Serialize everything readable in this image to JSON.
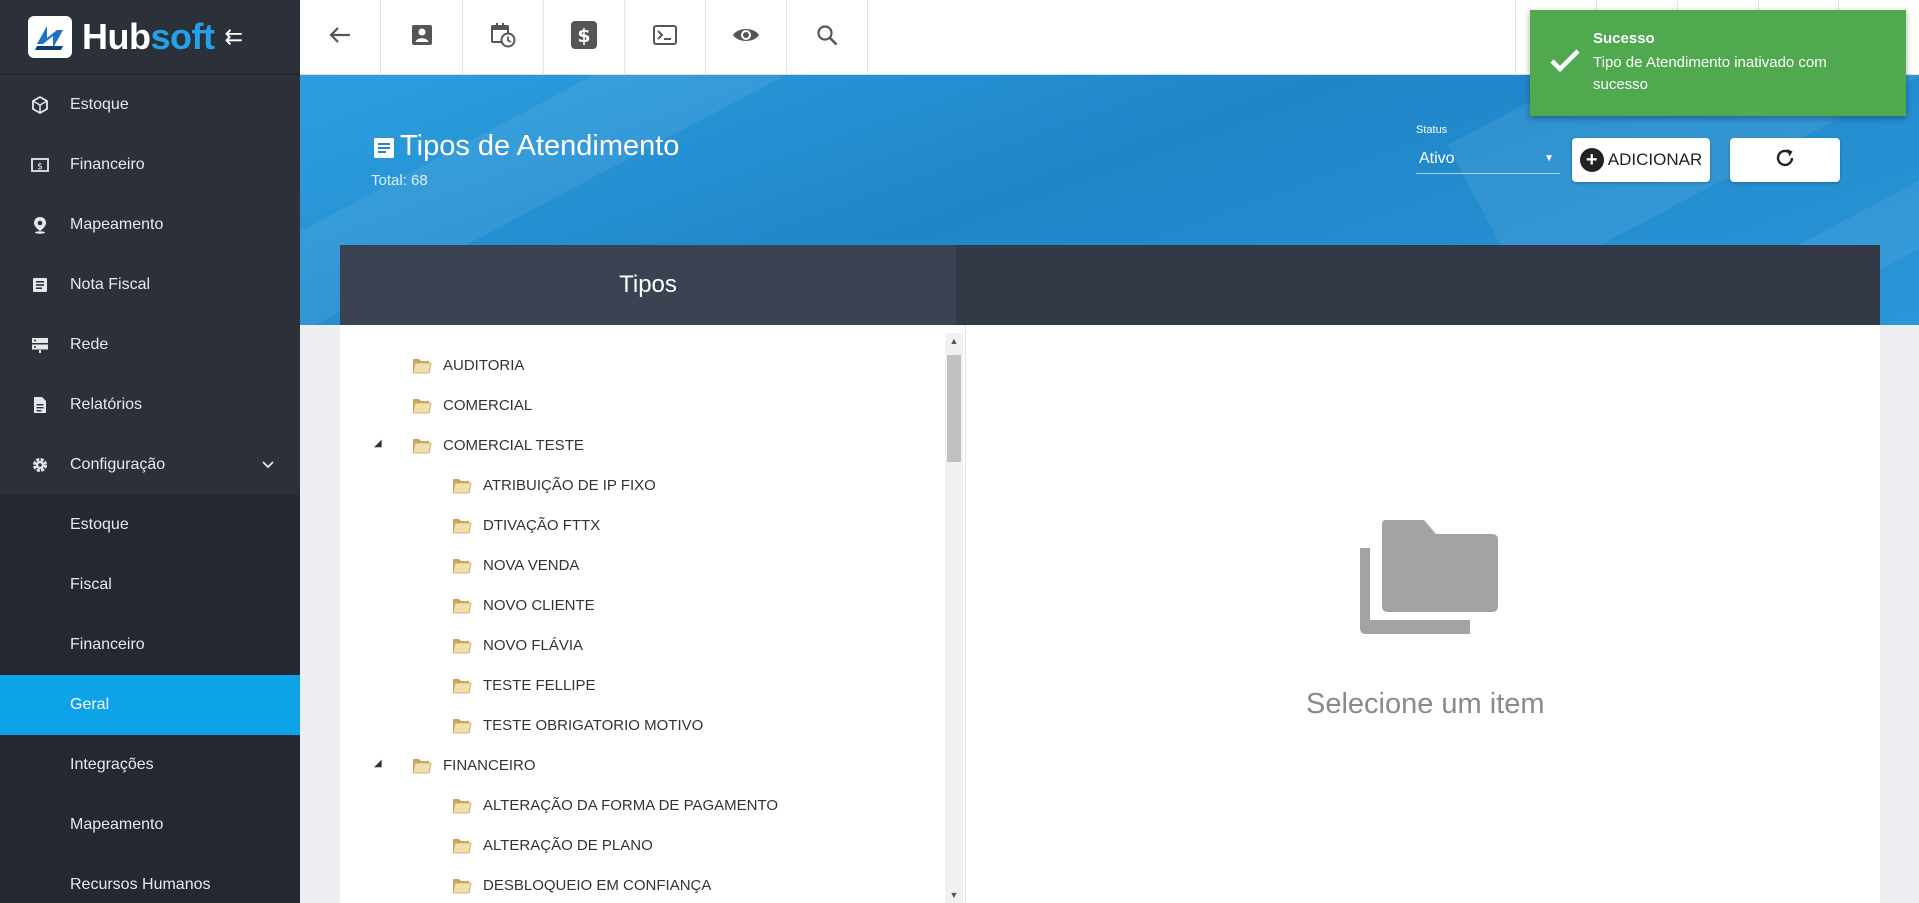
{
  "brand": {
    "name_part1": "Hub",
    "name_part2": "soft"
  },
  "sidebar": {
    "items": [
      {
        "label": "Estoque",
        "icon": "cube-icon"
      },
      {
        "label": "Financeiro",
        "icon": "money-icon"
      },
      {
        "label": "Mapeamento",
        "icon": "map-pin-icon"
      },
      {
        "label": "Nota Fiscal",
        "icon": "document-list-icon"
      },
      {
        "label": "Rede",
        "icon": "server-icon"
      },
      {
        "label": "Relatórios",
        "icon": "report-icon"
      },
      {
        "label": "Configuração",
        "icon": "gear-icon"
      }
    ],
    "config_sub": [
      {
        "label": "Estoque"
      },
      {
        "label": "Fiscal"
      },
      {
        "label": "Financeiro"
      },
      {
        "label": "Geral",
        "active": true
      },
      {
        "label": "Integrações"
      },
      {
        "label": "Mapeamento"
      },
      {
        "label": "Recursos Humanos"
      }
    ]
  },
  "topbar": {
    "icons": [
      "back-arrow-icon",
      "contact-icon",
      "calendar-clock-icon",
      "dollar-icon",
      "terminal-icon",
      "eye-icon",
      "search-icon"
    ]
  },
  "page": {
    "title": "Tipos de Atendimento",
    "total": "Total: 68",
    "status_label": "Status",
    "status_value": "Ativo",
    "add_label": "ADICIONAR"
  },
  "tabs": {
    "tipos": "Tipos"
  },
  "tree": {
    "items": [
      {
        "label": "AUDITORIA",
        "level": 0
      },
      {
        "label": "COMERCIAL",
        "level": 0
      },
      {
        "label": "COMERCIAL TESTE",
        "level": 0,
        "expanded": true
      },
      {
        "label": "ATRIBUIÇÃO DE IP FIXO",
        "level": 1
      },
      {
        "label": "DTIVAÇÃO FTTX",
        "level": 1
      },
      {
        "label": "NOVA VENDA",
        "level": 1
      },
      {
        "label": "NOVO CLIENTE",
        "level": 1
      },
      {
        "label": "NOVO FLÁVIA",
        "level": 1
      },
      {
        "label": "TESTE FELLIPE",
        "level": 1
      },
      {
        "label": "TESTE OBRIGATORIO MOTIVO",
        "level": 1
      },
      {
        "label": "FINANCEIRO",
        "level": 0,
        "expanded": true
      },
      {
        "label": "ALTERAÇÃO DA FORMA DE PAGAMENTO",
        "level": 1
      },
      {
        "label": "ALTERAÇÃO DE PLANO",
        "level": 1
      },
      {
        "label": "DESBLOQUEIO EM CONFIANÇA",
        "level": 1
      }
    ]
  },
  "empty_state": {
    "text": "Selecione um item"
  },
  "toast": {
    "title": "Sucesso",
    "message": "Tipo de Atendimento inativado com sucesso"
  },
  "colors": {
    "sidebar_bg": "#2c3039",
    "active_item": "#0ea2e8",
    "banner": "#1f86c8",
    "toast": "#50a84f",
    "brand_accent": "#22a2e8"
  }
}
